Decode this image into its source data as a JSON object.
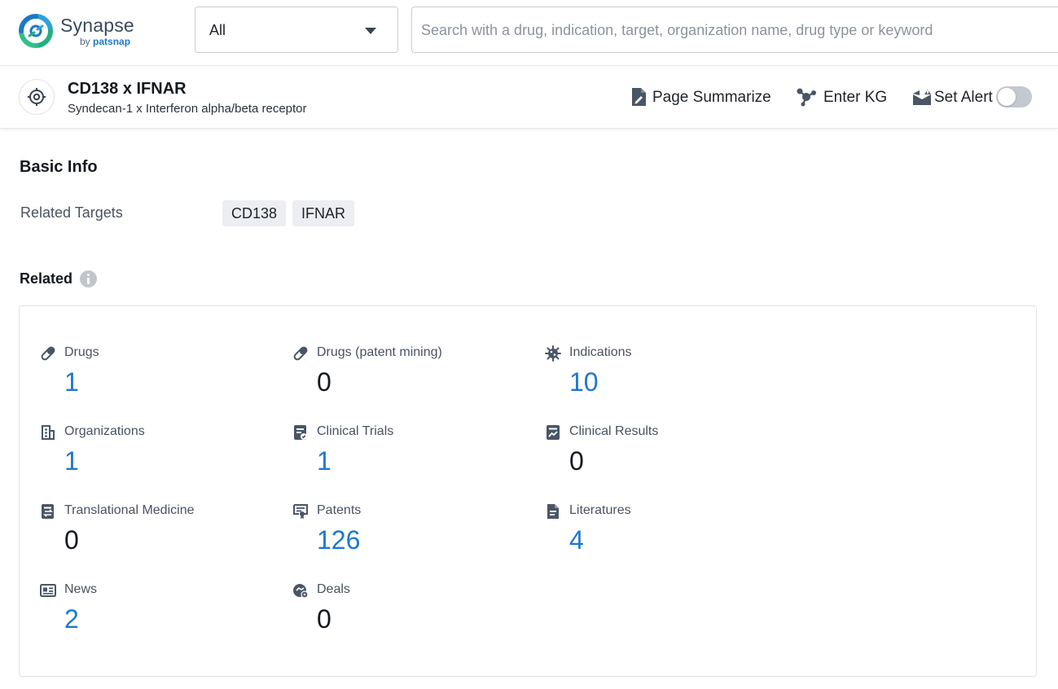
{
  "brand": {
    "name": "Synapse",
    "by_prefix": "by ",
    "by_brand": "patsnap"
  },
  "search": {
    "scope_value": "All",
    "placeholder": "Search with a drug, indication, target, organization name, drug type or keyword",
    "value": ""
  },
  "entity": {
    "title": "CD138 x IFNAR",
    "subtitle": "Syndecan-1 x Interferon alpha/beta receptor",
    "icon": "target-icon"
  },
  "actions": {
    "summarize_label": "Page Summarize",
    "kg_label": "Enter KG",
    "alert_label": "Set Alert",
    "alert_enabled": false
  },
  "basic_info": {
    "title": "Basic Info",
    "related_targets_label": "Related Targets",
    "targets": [
      "CD138",
      "IFNAR"
    ]
  },
  "related": {
    "title": "Related",
    "stats": [
      {
        "name": "Drugs",
        "count": "1",
        "icon": "pill-icon"
      },
      {
        "name": "Drugs (patent mining)",
        "count": "0",
        "icon": "pill-icon"
      },
      {
        "name": "Indications",
        "count": "10",
        "icon": "virus-icon"
      },
      {
        "name": "Organizations",
        "count": "1",
        "icon": "building-icon"
      },
      {
        "name": "Clinical Trials",
        "count": "1",
        "icon": "clipboard-icon"
      },
      {
        "name": "Clinical Results",
        "count": "0",
        "icon": "chart-doc-icon"
      },
      {
        "name": "Translational Medicine",
        "count": "0",
        "icon": "doc-exchange-icon"
      },
      {
        "name": "Patents",
        "count": "126",
        "icon": "certificate-icon"
      },
      {
        "name": "Literatures",
        "count": "4",
        "icon": "document-icon"
      },
      {
        "name": "News",
        "count": "2",
        "icon": "newspaper-icon"
      },
      {
        "name": "Deals",
        "count": "0",
        "icon": "handshake-icon"
      }
    ]
  },
  "colors": {
    "link_blue": "#1f77d0",
    "brand_green": "#22b07d",
    "brand_blue": "#1f77c9"
  }
}
